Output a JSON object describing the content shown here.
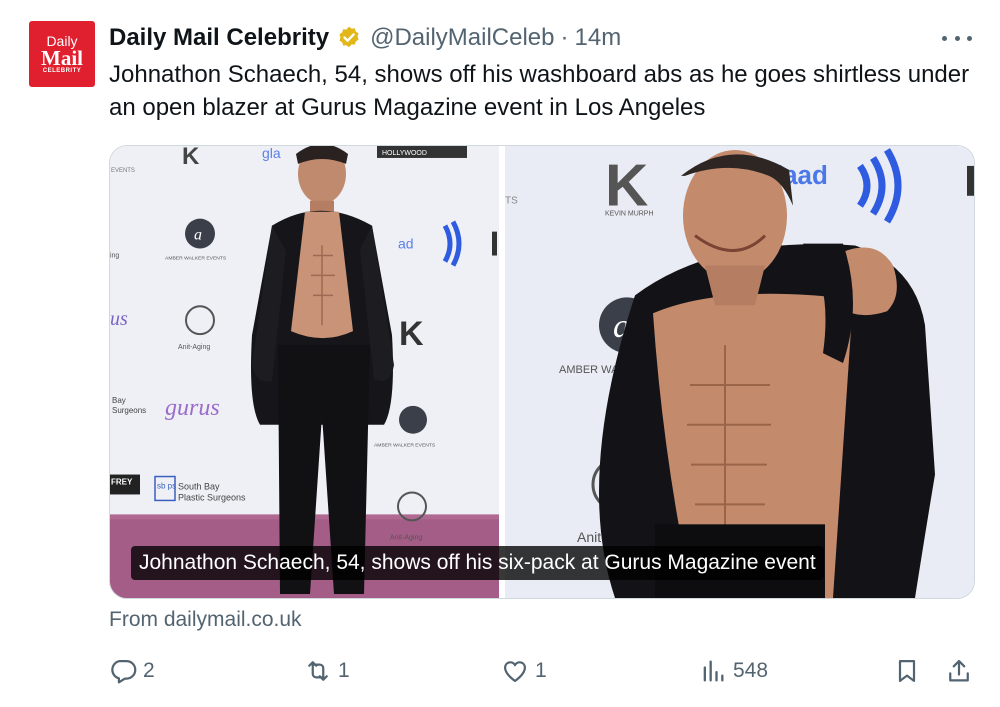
{
  "account": {
    "avatar_line1": "Daily",
    "avatar_line2": "Mail",
    "avatar_line3": "CELEBRITY",
    "name": "Daily Mail Celebrity",
    "handle": "@DailyMailCeleb",
    "separator": "·",
    "time": "14m"
  },
  "tweet": {
    "text": "Johnathon Schaech, 54, shows off his washboard abs as he goes shirtless under an open blazer at Gurus Magazine event in Los Angeles"
  },
  "media": {
    "caption": "Johnathon Schaech, 54, shows off his six-pack at Gurus Magazine event",
    "left_backdrop": {
      "glaad_top": "gla",
      "hollywood": "HOLLYWOOD",
      "events": "EVENTS",
      "ing": "ing",
      "us": "us",
      "amber": "AMBER WALKER EVENTS",
      "antiaging1": "Anit-Aging",
      "bay": "Bay",
      "surgeons": "Surgeons",
      "gurus": "gurus",
      "glaad_mid": "ad",
      "amber2": "AMBER WALKER EVENTS",
      "frey": "FREY",
      "sb": "sb ps",
      "southbay": "South Bay",
      "plastic": "Plastic Surgeons",
      "antiaging2": "Anit-Aging"
    },
    "right_backdrop": {
      "kevin": "KEVIN MURPH",
      "glaad": "glaad",
      "amber": "AMBER WALKE",
      "r3": "R3",
      "antiaging": "Anit-Agi"
    }
  },
  "link_source": "From dailymail.co.uk",
  "actions": {
    "replies": "2",
    "reposts": "1",
    "likes": "1",
    "views": "548"
  },
  "colors": {
    "brand_red": "#e0202e",
    "verified_gold": "#e2b719",
    "secondary_text": "#536471",
    "carpet": "#b06a92"
  },
  "icons": [
    "verified-badge-icon",
    "more-icon",
    "reply-icon",
    "repost-icon",
    "like-icon",
    "views-icon",
    "bookmark-icon",
    "share-icon"
  ]
}
